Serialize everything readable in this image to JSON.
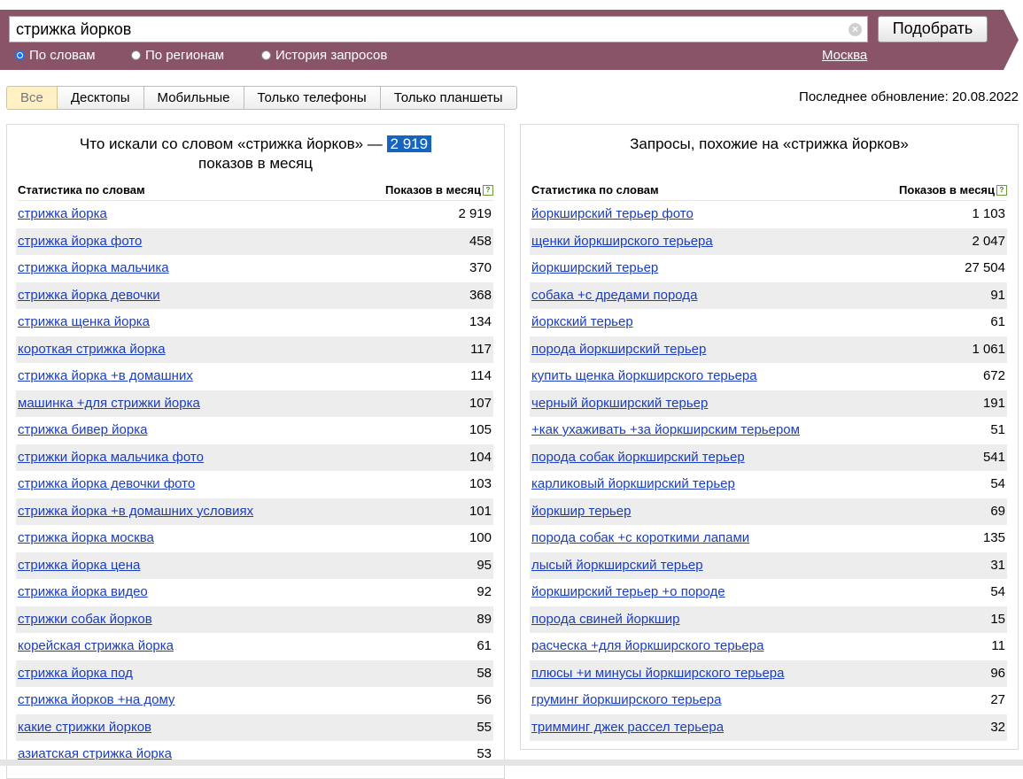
{
  "search": {
    "query": "стрижка йорков",
    "submit_label": "Подобрать",
    "clear_symbol": "×"
  },
  "modes": [
    {
      "label": "По словам",
      "selected": true
    },
    {
      "label": "По регионам",
      "selected": false
    },
    {
      "label": "История запросов",
      "selected": false
    }
  ],
  "region": "Москва",
  "tabs": [
    {
      "label": "Все",
      "active": true
    },
    {
      "label": "Десктопы",
      "active": false
    },
    {
      "label": "Мобильные",
      "active": false
    },
    {
      "label": "Только телефоны",
      "active": false
    },
    {
      "label": "Только планшеты",
      "active": false
    }
  ],
  "last_update": "Последнее обновление: 20.08.2022",
  "left": {
    "title_prefix": "Что искали со словом «стрижка йорков» —",
    "total": "2 919",
    "title_suffix": "показов в месяц",
    "col_word": "Статистика по словам",
    "col_count": "Показов в месяц",
    "rows": [
      {
        "phrase": "стрижка йорка",
        "count": "2 919"
      },
      {
        "phrase": "стрижка йорка фото",
        "count": "458"
      },
      {
        "phrase": "стрижка йорка мальчика",
        "count": "370"
      },
      {
        "phrase": "стрижка йорка девочки",
        "count": "368"
      },
      {
        "phrase": "стрижка щенка йорка",
        "count": "134"
      },
      {
        "phrase": "короткая стрижка йорка",
        "count": "117"
      },
      {
        "phrase": "стрижка йорка +в домашних",
        "count": "114"
      },
      {
        "phrase": "машинка +для стрижки йорка",
        "count": "107"
      },
      {
        "phrase": "стрижка бивер йорка",
        "count": "105"
      },
      {
        "phrase": "стрижки йорка мальчика фото",
        "count": "104"
      },
      {
        "phrase": "стрижка йорка девочки фото",
        "count": "103"
      },
      {
        "phrase": "стрижка йорка +в домашних условиях",
        "count": "101"
      },
      {
        "phrase": "стрижка йорка москва",
        "count": "100"
      },
      {
        "phrase": "стрижка йорка цена",
        "count": "95"
      },
      {
        "phrase": "стрижка йорка видео",
        "count": "92"
      },
      {
        "phrase": "стрижки собак йорков",
        "count": "89"
      },
      {
        "phrase": "корейская стрижка йорка",
        "count": "61"
      },
      {
        "phrase": "стрижка йорка под",
        "count": "58"
      },
      {
        "phrase": "стрижка йорков +на дому",
        "count": "56"
      },
      {
        "phrase": "какие стрижки йорков",
        "count": "55"
      },
      {
        "phrase": "азиатская стрижка йорка",
        "count": "53"
      }
    ]
  },
  "right": {
    "title": "Запросы, похожие на «стрижка йорков»",
    "col_word": "Статистика по словам",
    "col_count": "Показов в месяц",
    "rows": [
      {
        "phrase": "йоркширский терьер фото",
        "count": "1 103"
      },
      {
        "phrase": "щенки йоркширского терьера",
        "count": "2 047"
      },
      {
        "phrase": "йоркширский терьер",
        "count": "27 504"
      },
      {
        "phrase": "собака +с дредами порода",
        "count": "91"
      },
      {
        "phrase": "йоркский терьер",
        "count": "61"
      },
      {
        "phrase": "порода йоркширский терьер",
        "count": "1 061"
      },
      {
        "phrase": "купить щенка йоркширского терьера",
        "count": "672"
      },
      {
        "phrase": "черный йоркширский терьер",
        "count": "191"
      },
      {
        "phrase": "+как ухаживать +за йоркширским терьером",
        "count": "51"
      },
      {
        "phrase": "порода собак йоркширский терьер",
        "count": "541"
      },
      {
        "phrase": "карликовый йоркширский терьер",
        "count": "54"
      },
      {
        "phrase": "йоркшир терьер",
        "count": "69"
      },
      {
        "phrase": "порода собак +с короткими лапами",
        "count": "135"
      },
      {
        "phrase": "лысый йоркширский терьер",
        "count": "31"
      },
      {
        "phrase": "йоркширский терьер +о породе",
        "count": "54"
      },
      {
        "phrase": "порода свиней йоркшир",
        "count": "15"
      },
      {
        "phrase": "расческа +для йоркширского терьера",
        "count": "11"
      },
      {
        "phrase": "плюсы +и минусы йоркширского терьера",
        "count": "96"
      },
      {
        "phrase": "груминг йоркширского терьера",
        "count": "27"
      },
      {
        "phrase": "тримминг джек рассел терьера",
        "count": "32"
      }
    ]
  },
  "colors": {
    "band": "#8a5468",
    "link": "#1a3dc1",
    "highlight": "#1565c0",
    "active_tab": "#fff1c4"
  },
  "icons": {
    "help": "help-icon",
    "clear": "clear-icon"
  }
}
